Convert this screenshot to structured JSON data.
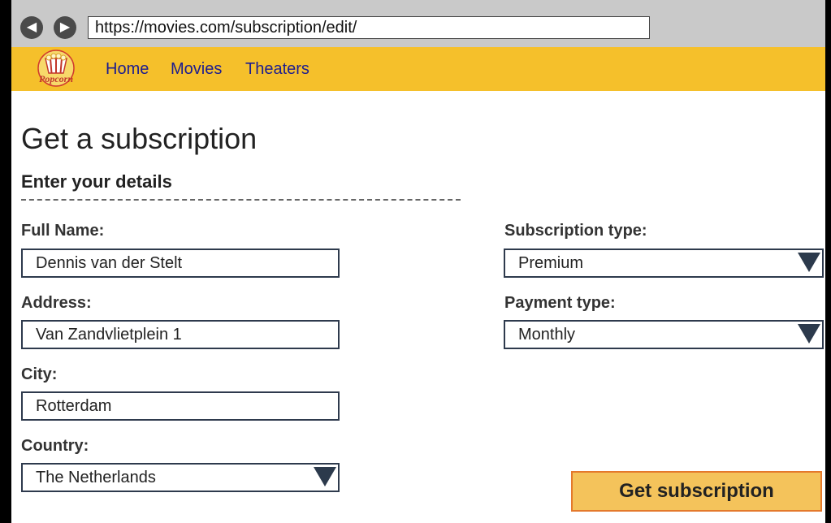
{
  "browser": {
    "url": "https://movies.com/subscription/edit/",
    "back_icon": "arrow-left-icon",
    "forward_icon": "arrow-right-icon"
  },
  "navbar": {
    "logo_text": "Popcorn",
    "links": [
      "Home",
      "Movies",
      "Theaters"
    ],
    "color": "#f5c02b"
  },
  "page": {
    "title": "Get a subscription",
    "section_title": "Enter your details"
  },
  "form": {
    "full_name": {
      "label": "Full Name:",
      "value": "Dennis van der Stelt"
    },
    "address": {
      "label": "Address:",
      "value": "Van Zandvlietplein 1"
    },
    "city": {
      "label": "City:",
      "value": "Rotterdam"
    },
    "country": {
      "label": "Country:",
      "value": "The Netherlands"
    },
    "subscription_type": {
      "label": "Subscription type:",
      "value": "Premium"
    },
    "payment_type": {
      "label": "Payment type:",
      "value": "Monthly"
    }
  },
  "submit": {
    "label": "Get subscription",
    "bg": "#f4c35b",
    "border": "#e4792c"
  }
}
